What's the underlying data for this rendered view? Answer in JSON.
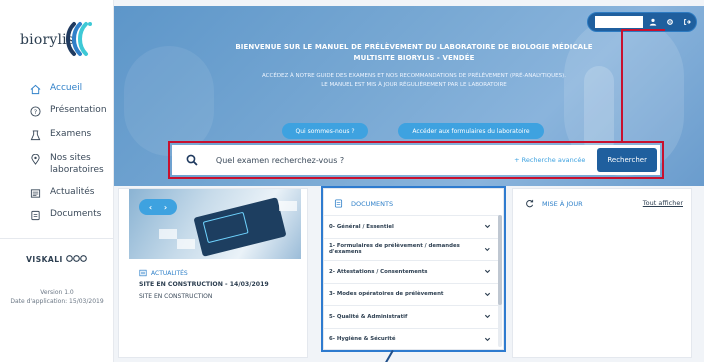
{
  "brand": {
    "name": "biorylis"
  },
  "sidebar": {
    "items": [
      {
        "label": "Accueil",
        "icon": "home-icon",
        "active": true
      },
      {
        "label": "Présentation",
        "icon": "help-circle-icon",
        "active": false
      },
      {
        "label": "Examens",
        "icon": "flask-icon",
        "active": false
      },
      {
        "label": "Nos sites laboratoires",
        "icon": "location-pin-icon",
        "active": false
      },
      {
        "label": "Actualités",
        "icon": "newspaper-icon",
        "active": false
      },
      {
        "label": "Documents",
        "icon": "document-icon",
        "active": false
      }
    ],
    "partner": "VISKALI",
    "version_line1": "Version 1.0",
    "version_line2": "Date d'application: 15/03/2019"
  },
  "hero": {
    "title": "BIENVENUE SUR LE MANUEL DE PRÉLÈVEMENT DU LABORATOIRE DE BIOLOGIE MÉDICALE MULTISITE BIORYLIS - VENDÉE",
    "subtitle_line1": "ACCÉDEZ À NOTRE GUIDE DES EXAMENS ET NOS RECOMMANDATIONS DE PRÉLÈVEMENT (PRÉ-ANALYTIQUES).",
    "subtitle_line2": "LE MANUEL EST MIS À JOUR RÉGULIÈREMENT PAR LE LABORATOIRE",
    "button_about": "Qui sommes-nous ?",
    "button_forms": "Accéder aux formulaires du laboratoire"
  },
  "search": {
    "placeholder": "Quel examen recherchez-vous ?",
    "advanced_label": "+ Recherche avancée",
    "button_label": "Rechercher"
  },
  "news": {
    "section_label": "ACTUALITÉS",
    "title": "SITE EN CONSTRUCTION - 14/03/2019",
    "text": "SITE EN CONSTRUCTION"
  },
  "documents": {
    "title": "DOCUMENTS",
    "items": [
      "0- Général / Essentiel",
      "1- Formulaires de prélèvement / demandes d'examens",
      "2- Attestations / Consentements",
      "3- Modes opératoires de prélèvement",
      "5- Qualité & Administratif",
      "6- Hygiène & Sécurité"
    ]
  },
  "updates": {
    "title": "MISE À JOUR",
    "show_all": "Tout afficher"
  },
  "colors": {
    "accent": "#2f80c9",
    "primary_dark": "#1f5f9e",
    "highlight_red": "#c8102e",
    "highlight_blue": "#2e7bcf"
  }
}
